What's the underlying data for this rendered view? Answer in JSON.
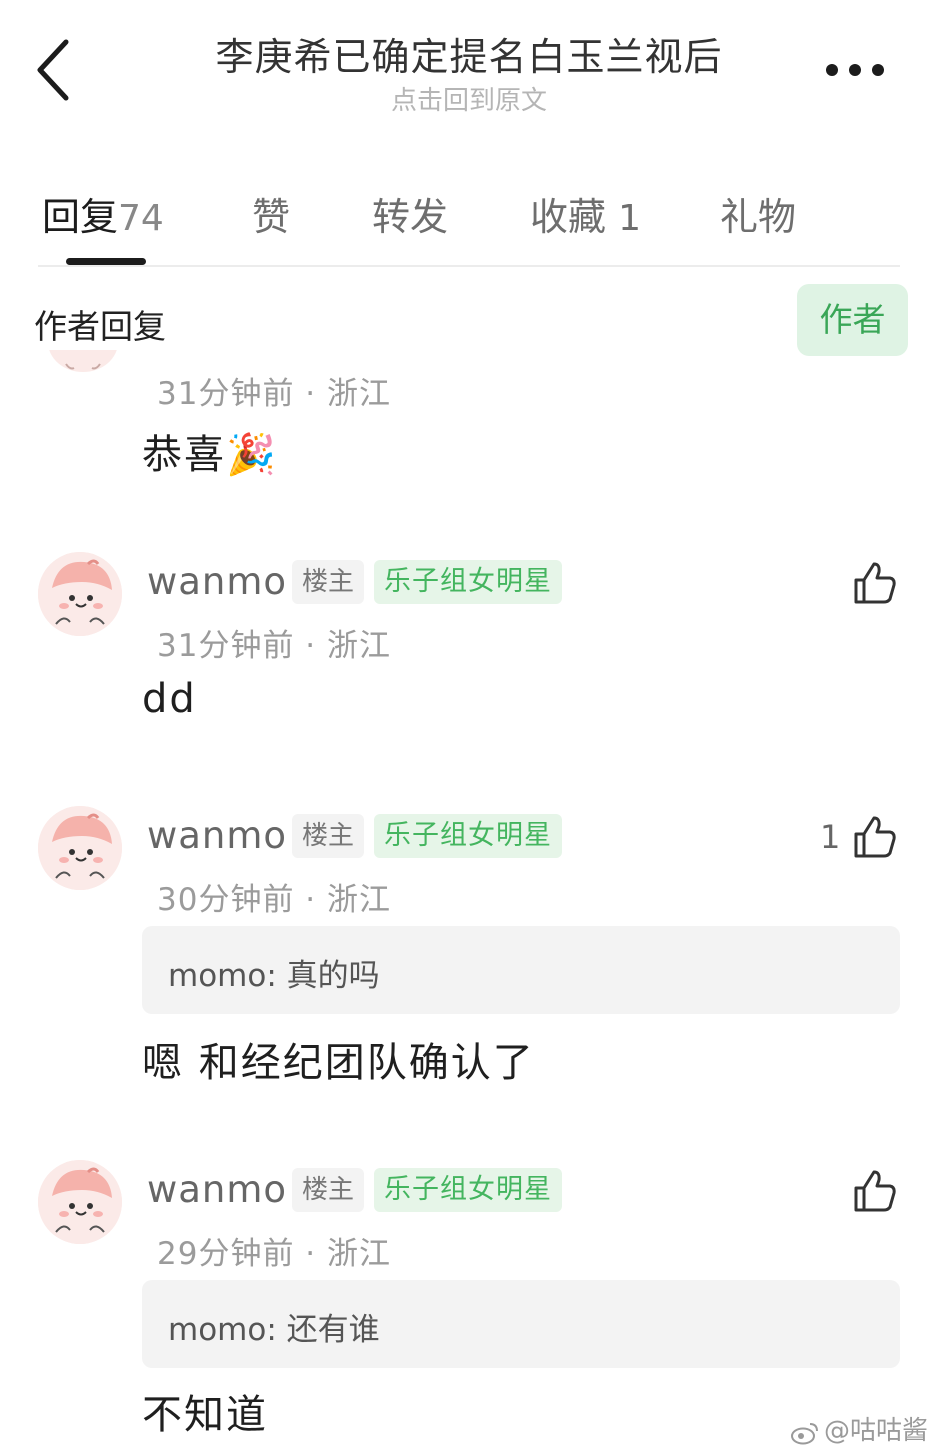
{
  "header": {
    "title": "李庚希已确定提名白玉兰视后",
    "subtitle": "点击回到原文"
  },
  "tabs": [
    {
      "label": "回复",
      "count": "74"
    },
    {
      "label": "赞",
      "count": ""
    },
    {
      "label": "转发",
      "count": ""
    },
    {
      "label": "收藏",
      "count": "1"
    },
    {
      "label": "礼物",
      "count": ""
    }
  ],
  "author_filter": {
    "label": "作者回复",
    "chip": "作者"
  },
  "comments": [
    {
      "username": "",
      "time_location": "31分钟前 · 浙江",
      "text": "恭喜🎉",
      "likes": ""
    },
    {
      "username": "wanmo",
      "op_badge": "楼主",
      "title_badge": "乐子组女明星",
      "time_location": "31分钟前 · 浙江",
      "text": "dd",
      "likes": ""
    },
    {
      "username": "wanmo",
      "op_badge": "楼主",
      "title_badge": "乐子组女明星",
      "time_location": "30分钟前 · 浙江",
      "quote": "momo: 真的吗",
      "text": "嗯 和经纪团队确认了",
      "likes": "1"
    },
    {
      "username": "wanmo",
      "op_badge": "楼主",
      "title_badge": "乐子组女明星",
      "time_location": "29分钟前 · 浙江",
      "quote": "momo: 还有谁",
      "text": "不知道",
      "likes": ""
    }
  ],
  "watermark": "@咕咕酱",
  "colors": {
    "accent_green": "#44b55f",
    "chip_bg": "#dff3e4",
    "text_dark": "#1f1f1f",
    "text_muted": "#9b9b9b"
  },
  "icons": {
    "back": "chevron-left-icon",
    "more": "more-dots-icon",
    "like": "thumbs-up-icon",
    "avatar": "peach-cartoon-avatar",
    "watermark": "weibo-logo-icon"
  }
}
